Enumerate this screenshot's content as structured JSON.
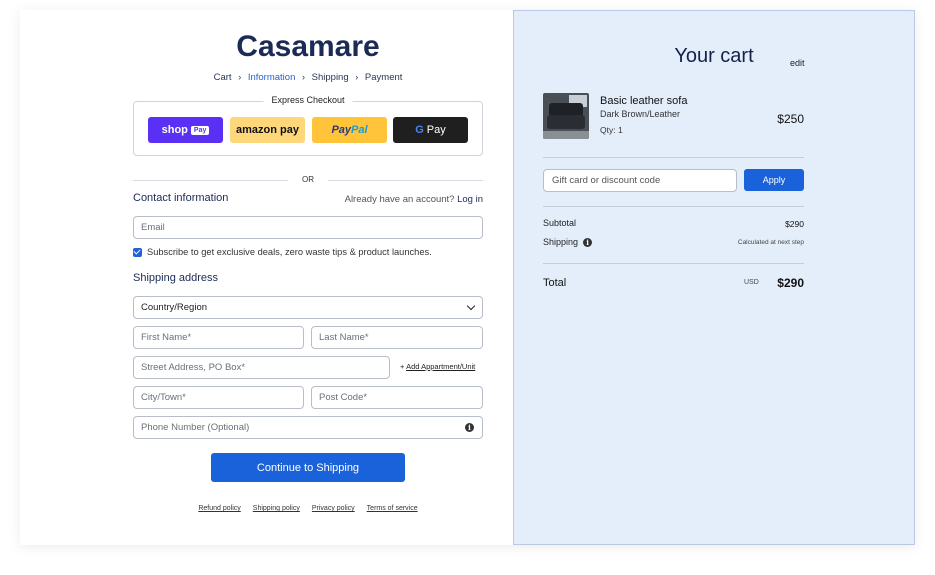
{
  "brand": "Casamare",
  "breadcrumb": {
    "items": [
      "Cart",
      "Information",
      "Shipping",
      "Payment"
    ],
    "separator": "›",
    "active": "Information"
  },
  "express": {
    "label": "Express Checkout",
    "shop_pay": {
      "text": "shop",
      "badge": "Pay"
    },
    "amazon_pay": "amazon pay",
    "paypal": {
      "pay": "Pay",
      "pal": "Pal"
    },
    "gpay": {
      "g": "G",
      "text": "Pay"
    }
  },
  "or_text": "OR",
  "contact": {
    "title": "Contact information",
    "account_prompt": "Already have an account?",
    "login_link": "Log in",
    "email_placeholder": "Email",
    "subscribe_text": "Subscribe to get exclusive deals, zero waste tips & product launches."
  },
  "shipping": {
    "title": "Shipping address",
    "country": "Country/Region",
    "first_name": "First Name*",
    "last_name": "Last Name*",
    "street": "Street Address, PO Box*",
    "add_apartment": "Add Appartment/Unit",
    "add_symbol": "+",
    "city": "City/Town*",
    "post_code": "Post Code*",
    "phone": "Phone Number (Optional)"
  },
  "continue_button": "Continue to Shipping",
  "policies": [
    "Refund policy",
    "Shipping policy",
    "Privacy policy",
    "Terms of service"
  ],
  "cart": {
    "title": "Your cart",
    "edit": "edit",
    "item": {
      "name": "Basic leather sofa",
      "variant": "Dark Brown/Leather",
      "qty": "Qty: 1",
      "price": "$250"
    },
    "discount_placeholder": "Gift card or discount code",
    "apply": "Apply",
    "subtotal_label": "Subtotal",
    "subtotal_value": "$290",
    "shipping_label": "Shipping",
    "shipping_value": "Calculated at next step",
    "total_label": "Total",
    "currency": "USD",
    "total_value": "$290"
  },
  "colors": {
    "accent": "#1a62d9",
    "brand_text": "#1b2b55",
    "cart_bg": "#e4eefb",
    "shop_pay": "#5a31f4",
    "amazon_pay": "#fdd77a",
    "paypal": "#ffc439",
    "gpay": "#1f1f1f"
  }
}
